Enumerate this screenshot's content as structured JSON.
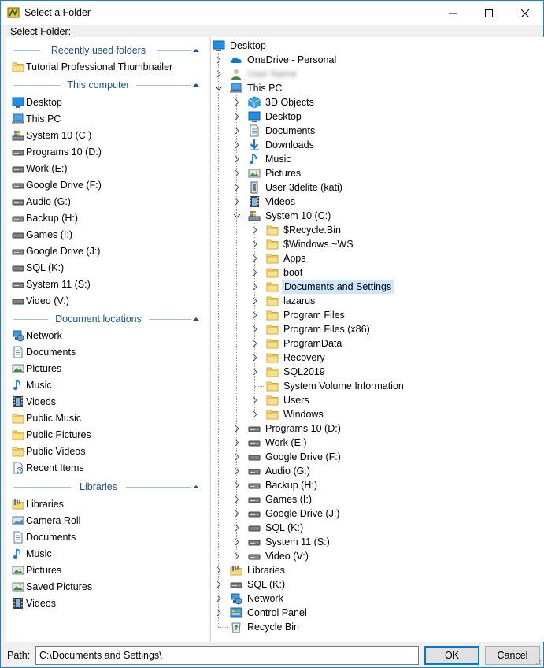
{
  "window": {
    "title": "Select a Folder",
    "sublabel": "Select Folder:"
  },
  "left": {
    "sections": [
      {
        "title": "Recently used folders",
        "items": [
          {
            "label": "Tutorial Professional Thumbnailer",
            "icon": "folder-icon"
          }
        ]
      },
      {
        "title": "This computer",
        "items": [
          {
            "label": "Desktop",
            "icon": "desktop-icon"
          },
          {
            "label": "This PC",
            "icon": "computer-icon"
          },
          {
            "label": "System 10 (C:)",
            "icon": "system-drive-icon"
          },
          {
            "label": "Programs 10 (D:)",
            "icon": "drive-icon"
          },
          {
            "label": "Work (E:)",
            "icon": "drive-icon"
          },
          {
            "label": "Google Drive (F:)",
            "icon": "drive-icon"
          },
          {
            "label": "Audio (G:)",
            "icon": "drive-icon"
          },
          {
            "label": "Backup (H:)",
            "icon": "drive-icon"
          },
          {
            "label": "Games (I:)",
            "icon": "drive-icon"
          },
          {
            "label": "Google Drive (J:)",
            "icon": "drive-icon"
          },
          {
            "label": "SQL (K:)",
            "icon": "drive-icon"
          },
          {
            "label": "System 11 (S:)",
            "icon": "drive-icon"
          },
          {
            "label": "Video (V:)",
            "icon": "drive-icon"
          }
        ]
      },
      {
        "title": "Document locations",
        "items": [
          {
            "label": "Network",
            "icon": "network-icon"
          },
          {
            "label": "Documents",
            "icon": "documents-icon"
          },
          {
            "label": "Pictures",
            "icon": "pictures-icon"
          },
          {
            "label": "Music",
            "icon": "music-icon"
          },
          {
            "label": "Videos",
            "icon": "videos-icon"
          },
          {
            "label": "Public Music",
            "icon": "folder-icon"
          },
          {
            "label": "Public Pictures",
            "icon": "folder-icon"
          },
          {
            "label": "Public Videos",
            "icon": "folder-icon"
          },
          {
            "label": "Recent Items",
            "icon": "recent-items-icon"
          }
        ]
      },
      {
        "title": "Libraries",
        "items": [
          {
            "label": "Libraries",
            "icon": "libraries-icon"
          },
          {
            "label": "Camera Roll",
            "icon": "camera-roll-icon"
          },
          {
            "label": "Documents",
            "icon": "documents-icon"
          },
          {
            "label": "Music",
            "icon": "music-icon"
          },
          {
            "label": "Pictures",
            "icon": "pictures-icon"
          },
          {
            "label": "Saved Pictures",
            "icon": "pictures-icon"
          },
          {
            "label": "Videos",
            "icon": "videos-icon"
          }
        ]
      }
    ]
  },
  "tree": [
    {
      "label": "Desktop",
      "level": 0,
      "expander": "none",
      "icon": "desktop-icon"
    },
    {
      "label": "OneDrive - Personal",
      "level": 1,
      "expander": "collapsed",
      "icon": "onedrive-icon"
    },
    {
      "label": "User Name",
      "level": 1,
      "expander": "collapsed",
      "icon": "user-icon",
      "blurred": true
    },
    {
      "label": "This PC",
      "level": 1,
      "expander": "expanded",
      "icon": "computer-icon"
    },
    {
      "label": "3D Objects",
      "level": 2,
      "expander": "collapsed",
      "icon": "3d-objects-icon"
    },
    {
      "label": "Desktop",
      "level": 2,
      "expander": "collapsed",
      "icon": "desktop-icon"
    },
    {
      "label": "Documents",
      "level": 2,
      "expander": "collapsed",
      "icon": "documents-icon"
    },
    {
      "label": "Downloads",
      "level": 2,
      "expander": "collapsed",
      "icon": "downloads-icon"
    },
    {
      "label": "Music",
      "level": 2,
      "expander": "collapsed",
      "icon": "music-icon"
    },
    {
      "label": "Pictures",
      "level": 2,
      "expander": "collapsed",
      "icon": "pictures-icon"
    },
    {
      "label": "User 3delite (kati)",
      "level": 2,
      "expander": "collapsed",
      "icon": "user-folder-icon"
    },
    {
      "label": "Videos",
      "level": 2,
      "expander": "collapsed",
      "icon": "videos-icon"
    },
    {
      "label": "System 10 (C:)",
      "level": 2,
      "expander": "expanded",
      "icon": "system-drive-icon"
    },
    {
      "label": "$Recycle.Bin",
      "level": 3,
      "expander": "collapsed",
      "icon": "folder-icon"
    },
    {
      "label": "$Windows.~WS",
      "level": 3,
      "expander": "collapsed",
      "icon": "folder-icon"
    },
    {
      "label": "Apps",
      "level": 3,
      "expander": "collapsed",
      "icon": "folder-icon"
    },
    {
      "label": "boot",
      "level": 3,
      "expander": "collapsed",
      "icon": "folder-icon"
    },
    {
      "label": "Documents and Settings",
      "level": 3,
      "expander": "collapsed",
      "icon": "folder-icon",
      "selected": true
    },
    {
      "label": "lazarus",
      "level": 3,
      "expander": "collapsed",
      "icon": "folder-icon"
    },
    {
      "label": "Program Files",
      "level": 3,
      "expander": "collapsed",
      "icon": "folder-icon"
    },
    {
      "label": "Program Files (x86)",
      "level": 3,
      "expander": "collapsed",
      "icon": "folder-icon"
    },
    {
      "label": "ProgramData",
      "level": 3,
      "expander": "collapsed",
      "icon": "folder-icon"
    },
    {
      "label": "Recovery",
      "level": 3,
      "expander": "collapsed",
      "icon": "folder-icon"
    },
    {
      "label": "SQL2019",
      "level": 3,
      "expander": "collapsed",
      "icon": "folder-icon"
    },
    {
      "label": "System Volume Information",
      "level": 3,
      "expander": "none",
      "icon": "folder-icon"
    },
    {
      "label": "Users",
      "level": 3,
      "expander": "collapsed",
      "icon": "folder-icon"
    },
    {
      "label": "Windows",
      "level": 3,
      "expander": "collapsed",
      "icon": "folder-icon"
    },
    {
      "label": "Programs 10 (D:)",
      "level": 2,
      "expander": "collapsed",
      "icon": "drive-icon"
    },
    {
      "label": "Work (E:)",
      "level": 2,
      "expander": "collapsed",
      "icon": "drive-icon"
    },
    {
      "label": "Google Drive (F:)",
      "level": 2,
      "expander": "collapsed",
      "icon": "drive-icon"
    },
    {
      "label": "Audio (G:)",
      "level": 2,
      "expander": "collapsed",
      "icon": "drive-icon"
    },
    {
      "label": "Backup (H:)",
      "level": 2,
      "expander": "collapsed",
      "icon": "drive-icon"
    },
    {
      "label": "Games (I:)",
      "level": 2,
      "expander": "collapsed",
      "icon": "drive-icon"
    },
    {
      "label": "Google Drive (J:)",
      "level": 2,
      "expander": "collapsed",
      "icon": "drive-icon"
    },
    {
      "label": "SQL (K:)",
      "level": 2,
      "expander": "collapsed",
      "icon": "drive-icon"
    },
    {
      "label": "System 11 (S:)",
      "level": 2,
      "expander": "collapsed",
      "icon": "drive-icon"
    },
    {
      "label": "Video (V:)",
      "level": 2,
      "expander": "collapsed",
      "icon": "drive-icon"
    },
    {
      "label": "Libraries",
      "level": 1,
      "expander": "collapsed",
      "icon": "libraries-icon"
    },
    {
      "label": "SQL (K:)",
      "level": 1,
      "expander": "collapsed",
      "icon": "drive-icon"
    },
    {
      "label": "Network",
      "level": 1,
      "expander": "collapsed",
      "icon": "network-icon"
    },
    {
      "label": "Control Panel",
      "level": 1,
      "expander": "collapsed",
      "icon": "control-panel-icon"
    },
    {
      "label": "Recycle Bin",
      "level": 1,
      "expander": "none",
      "icon": "recycle-bin-icon"
    }
  ],
  "bottom": {
    "path_label": "Path:",
    "path_value": "C:\\Documents and Settings\\",
    "ok_label": "OK",
    "cancel_label": "Cancel"
  },
  "colors": {
    "accent": "#0078d7",
    "section_title": "#1e50a2",
    "selection": "#cce8ff",
    "folder": "#f8d775"
  }
}
